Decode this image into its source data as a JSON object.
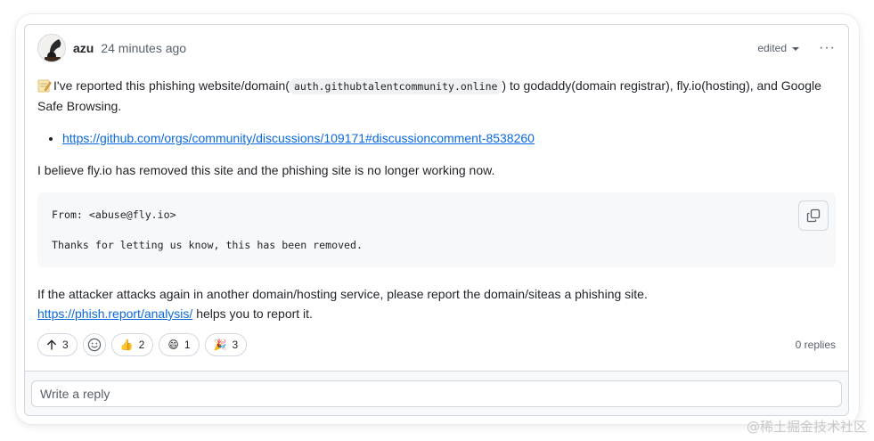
{
  "comment": {
    "author": "azu",
    "time": "24 minutes ago",
    "edited_label": "edited",
    "more_label": "···",
    "paragraph1": {
      "before_code": "I've reported this phishing website/domain(",
      "code": "auth.githubtalentcommunity.online",
      "after_code": ") to godaddy(domain registrar), fly.io(hosting), and Google Safe Browsing."
    },
    "link1": "https://github.com/orgs/community/discussions/109171#discussioncomment-8538260",
    "paragraph2": "I believe fly.io has removed this site and the phishing site is no longer working now.",
    "codeblock": {
      "line1": "From: <abuse@fly.io>",
      "line2": "",
      "line3": "Thanks for letting us know, this has been removed."
    },
    "paragraph3": "If the attacker attacks again in another domain/hosting service, please report the domain/siteas a phishing site.",
    "link2": "https://phish.report/analysis/",
    "paragraph3_after_link": " helps you to report it."
  },
  "footer": {
    "upvote_count": "3",
    "reactions": [
      {
        "icon": "thumbs-up-icon",
        "emoji": "👍",
        "count": "2"
      },
      {
        "icon": "smile-icon",
        "emoji": "😄",
        "count": "1"
      },
      {
        "icon": "party-icon",
        "emoji": "🎉",
        "count": "3"
      }
    ],
    "replies": "0 replies"
  },
  "reply": {
    "placeholder": "Write a reply"
  },
  "watermark": "@稀土掘金技术社区"
}
